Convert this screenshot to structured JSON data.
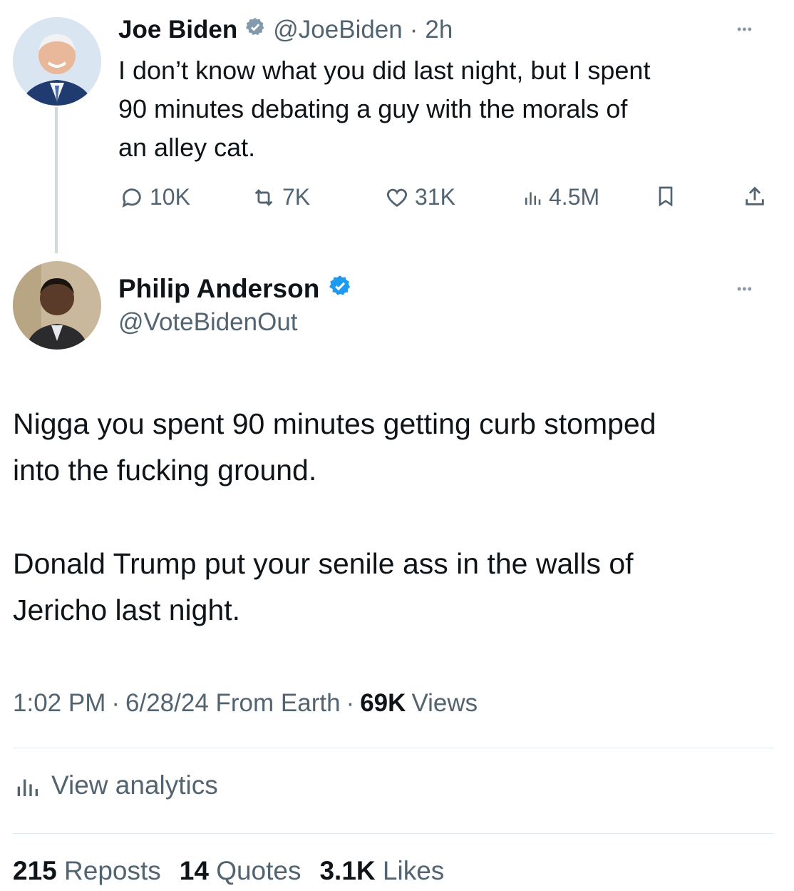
{
  "original_tweet": {
    "author_name": "Joe Biden",
    "handle": "@JoeBiden",
    "separator": "·",
    "time": "2h",
    "text_lines": [
      "I don’t know what you did last night, but I spent",
      "90 minutes debating a guy with the morals of",
      "an alley cat."
    ],
    "actions": {
      "replies": "10K",
      "reposts": "7K",
      "likes": "31K",
      "views": "4.5M"
    },
    "more_label": "•••",
    "verified_color": "#829aab",
    "avatar_icon": "avatar-photo"
  },
  "reply_tweet": {
    "author_name": "Philip Anderson",
    "handle": "@VoteBidenOut",
    "more_label": "•••",
    "verified_color": "#1d9bf0",
    "paragraph1_lines": [
      "Nigga you spent 90 minutes getting curb stomped",
      "into the fucking ground."
    ],
    "paragraph2_lines": [
      "Donald Trump put your senile ass in the walls of",
      "Jericho last night."
    ],
    "meta": {
      "time": "1:02 PM",
      "sep1": "·",
      "date_source": "6/28/24 From Earth",
      "sep2": "·",
      "views_count": "69K",
      "views_label": "Views"
    },
    "analytics_label": "View analytics",
    "stats": {
      "reposts_count": "215",
      "reposts_label": "Reposts",
      "quotes_count": "14",
      "quotes_label": "Quotes",
      "likes_count": "3.1K",
      "likes_label": "Likes"
    }
  },
  "colors": {
    "text_primary": "#0f1419",
    "text_secondary": "#536471",
    "divider": "#e1e8ed"
  }
}
